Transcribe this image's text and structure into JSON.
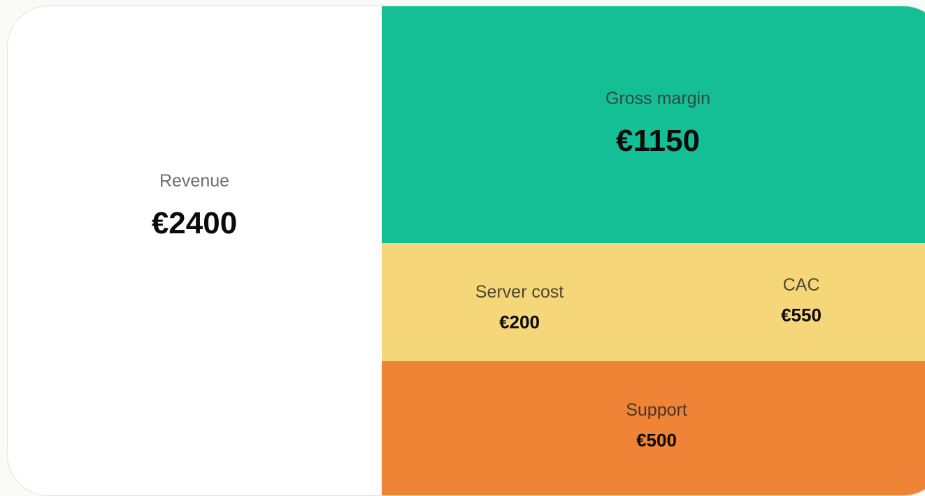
{
  "chart_data": {
    "type": "treemap",
    "currency": "€",
    "tiles": [
      {
        "key": "revenue",
        "label": "Revenue",
        "value": 2400,
        "display": "€2400",
        "color": "#ffffff"
      },
      {
        "key": "gross_margin",
        "label": "Gross margin",
        "value": 1150,
        "display": "€1150",
        "color": "#14bf96"
      },
      {
        "key": "server_cost",
        "label": "Server cost",
        "value": 200,
        "display": "€200",
        "color": "#f5d679"
      },
      {
        "key": "cac",
        "label": "CAC",
        "value": 550,
        "display": "€550",
        "color": "#f5d679"
      },
      {
        "key": "support",
        "label": "Support",
        "value": 500,
        "display": "€500",
        "color": "#ef8336"
      }
    ]
  }
}
